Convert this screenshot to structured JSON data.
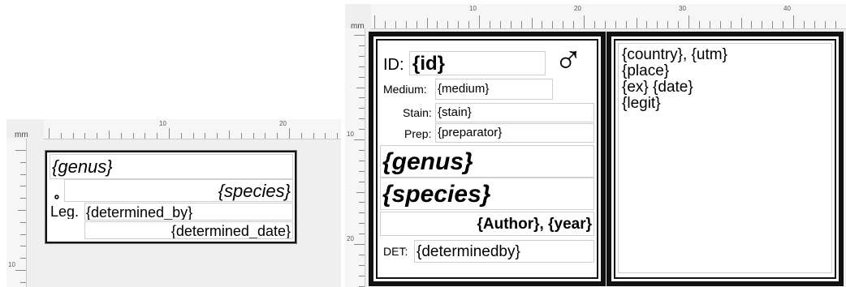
{
  "ruler_unit": "mm",
  "left_designer": {
    "ruler_ticks": [
      "10",
      "20"
    ],
    "vruler_ticks": [
      "10"
    ],
    "label": {
      "genus": "{genus}",
      "species": "{species}",
      "sex_symbol": "⚬",
      "leg_label": "Leg.",
      "determined_by": "{determined_by}",
      "determined_date": "{determined_date}"
    }
  },
  "right_designer": {
    "ruler_ticks": [
      "10",
      "20",
      "30",
      "40"
    ],
    "vruler_ticks": [
      "10",
      "20"
    ],
    "label": {
      "id_label": "ID:",
      "id_value": "{id}",
      "male_symbol": "♂",
      "medium_label": "Medium:",
      "medium_value": "{medium}",
      "stain_label": "Stain:",
      "stain_value": "{stain}",
      "prep_label": "Prep:",
      "prep_value": "{preparator}",
      "genus": "{genus}",
      "species": "{species}",
      "author_year": "{Author}, {year}",
      "det_label": "DET:",
      "det_value": "{determinedby}",
      "country_utm": "{country}, {utm}",
      "place": "{place}",
      "ex_date": "{ex} {date}",
      "legit": "{legit}"
    }
  }
}
